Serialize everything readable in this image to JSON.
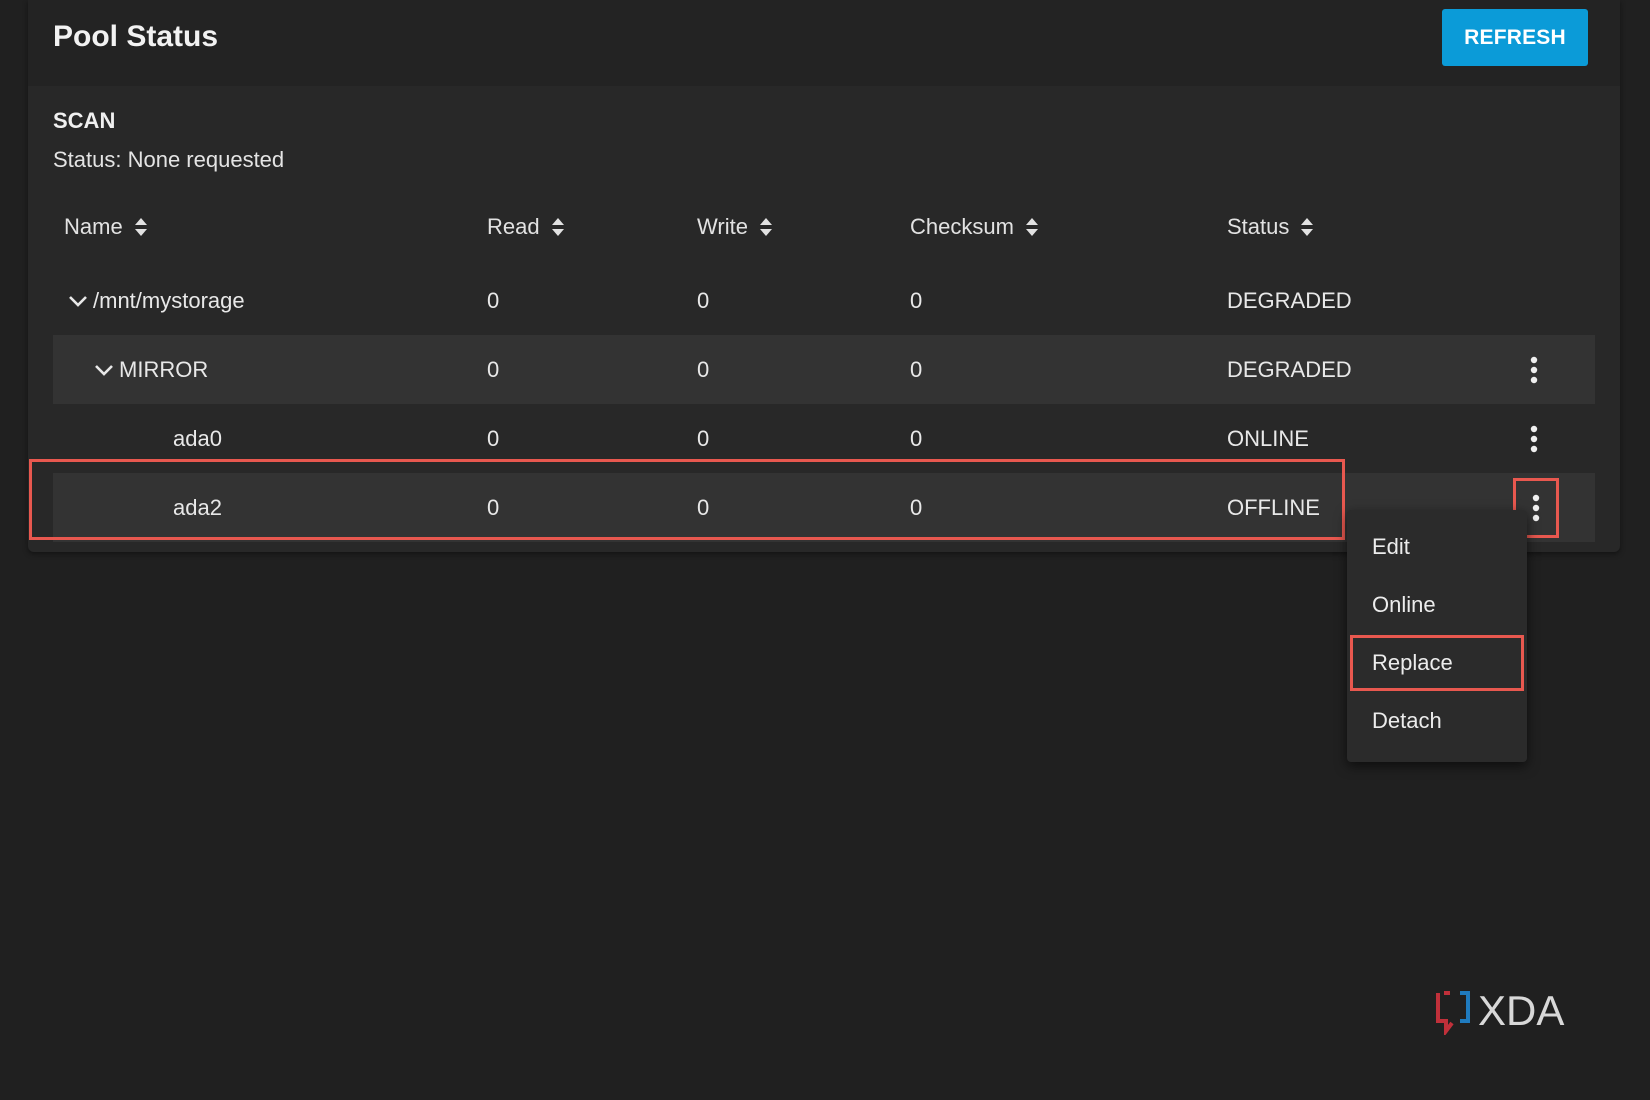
{
  "header": {
    "title": "Pool Status",
    "refresh_label": "REFRESH"
  },
  "scan": {
    "heading": "SCAN",
    "status": "Status: None requested"
  },
  "table": {
    "columns": [
      "Name",
      "Read",
      "Write",
      "Checksum",
      "Status"
    ],
    "rows": [
      {
        "name": "/mnt/mystorage",
        "read": "0",
        "write": "0",
        "checksum": "0",
        "status": "DEGRADED",
        "expanded": true,
        "level": 0
      },
      {
        "name": "MIRROR",
        "read": "0",
        "write": "0",
        "checksum": "0",
        "status": "DEGRADED",
        "expanded": true,
        "level": 1
      },
      {
        "name": "ada0",
        "read": "0",
        "write": "0",
        "checksum": "0",
        "status": "ONLINE",
        "level": 2
      },
      {
        "name": "ada2",
        "read": "0",
        "write": "0",
        "checksum": "0",
        "status": "OFFLINE",
        "level": 2,
        "highlighted": true
      }
    ]
  },
  "context_menu": {
    "items": [
      "Edit",
      "Online",
      "Replace",
      "Detach"
    ],
    "highlighted_item": "Replace"
  },
  "watermark": {
    "text": "XDA"
  },
  "colors": {
    "background": "#202020",
    "card": "#282828",
    "accent_button": "#0b9bd8",
    "highlight_outline": "#e8584f",
    "row_alt": "#333333"
  },
  "icons": {
    "sort": "sort-arrows-icon",
    "expand": "chevron-down-icon",
    "actions": "kebab-menu-icon"
  }
}
